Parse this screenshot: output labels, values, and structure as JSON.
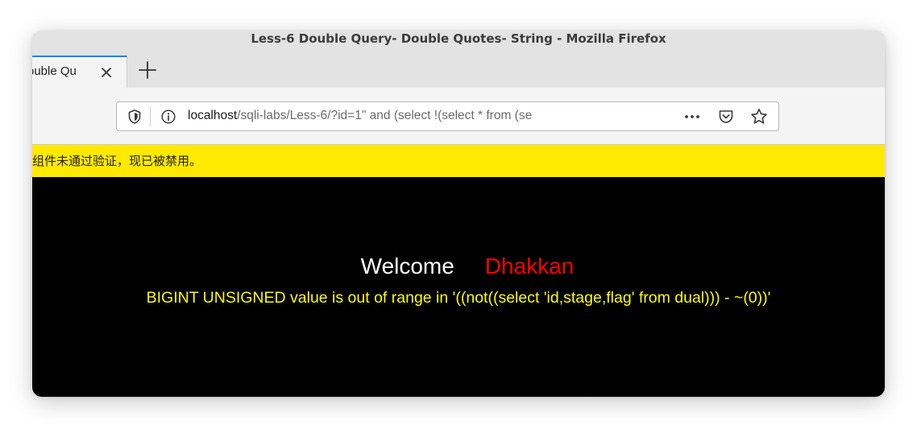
{
  "window": {
    "title": "Less-6 Double Query- Double Quotes- String - Mozilla Firefox"
  },
  "tabs": [
    {
      "label": "Less-6 Double Query- Double Quotes- String",
      "visible_text": "ouble Qu",
      "active": true
    }
  ],
  "urlbar": {
    "host": "localhost",
    "path": "/sqli-labs/Less-6/?id=1\" and (select !(select * from (se"
  },
  "notification": {
    "text": "组件未通过验证，现已被禁用。",
    "color": "#ffe900"
  },
  "page": {
    "welcome": "Welcome",
    "name": "Dhakkan",
    "error": "BIGINT UNSIGNED value is out of range in '((not((select 'id,stage,flag' from dual))) - ~(0))'",
    "colors": {
      "background": "#000000",
      "welcome": "#ffffff",
      "name": "#ff0000",
      "error": "#ffff00"
    }
  },
  "icons": [
    "shield-icon",
    "info-icon",
    "more-icon",
    "pocket-icon",
    "star-icon",
    "close-icon",
    "plus-icon"
  ],
  "accent": "#0a84ff"
}
